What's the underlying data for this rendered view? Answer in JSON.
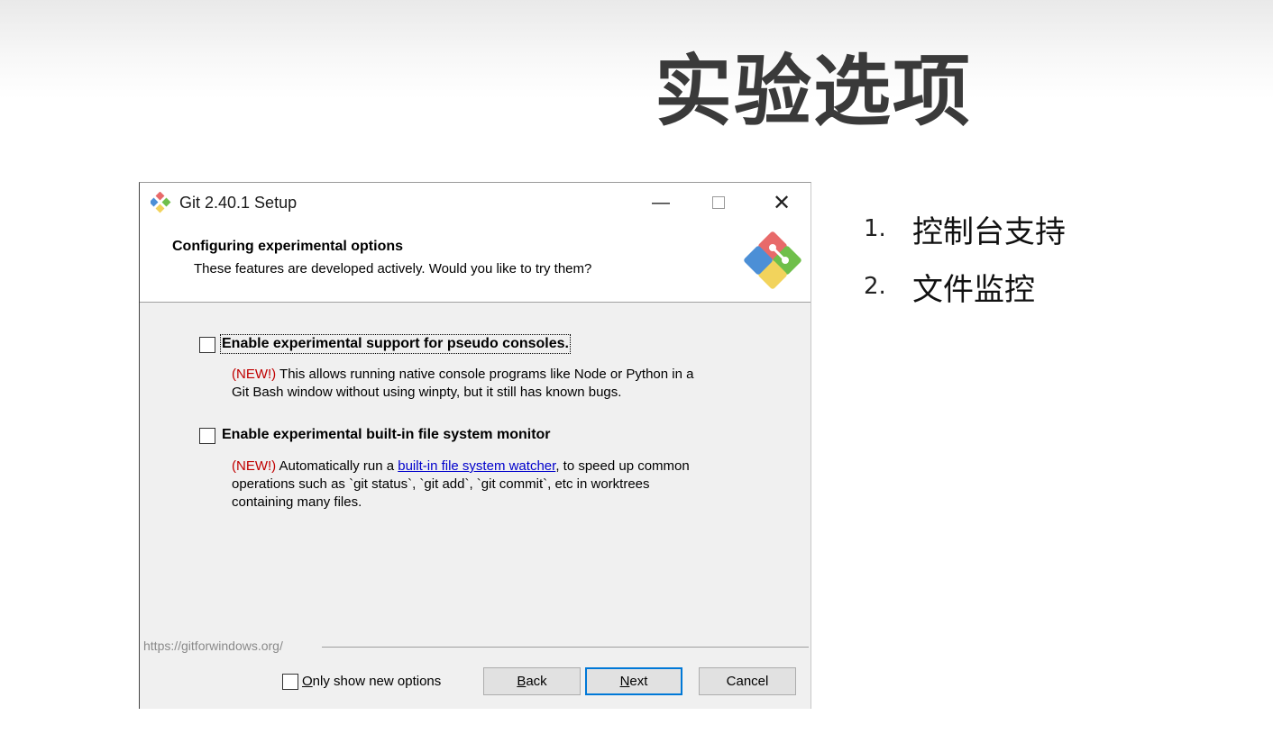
{
  "slide": {
    "title": "实验选项",
    "bullets": [
      {
        "num": "1.",
        "text": "控制台支持"
      },
      {
        "num": "2.",
        "text": "文件监控"
      }
    ]
  },
  "dialog": {
    "title": "Git 2.40.1 Setup",
    "window_controls": {
      "minimize": "—",
      "close": "✕"
    },
    "header_title": "Configuring experimental options",
    "header_subtitle": "These features are developed actively. Would you like to try them?",
    "options": [
      {
        "label": "Enable experimental support for pseudo consoles.",
        "checked": false,
        "new_tag": "(NEW!)",
        "desc_line1": " This allows running native console programs like Node or Python in a",
        "desc_line2": "Git Bash window without using winpty, but it still has known bugs."
      },
      {
        "label": "Enable experimental built-in file system monitor",
        "checked": false,
        "new_tag": "(NEW!)",
        "desc_pre": " Automatically run a ",
        "desc_link": "built-in file system watcher",
        "desc_post": ", to speed up common",
        "desc_line2": "operations such as `git status`, `git add`, `git commit`, etc in worktrees",
        "desc_line3": "containing many files."
      }
    ],
    "footer_url": "https://gitforwindows.org/",
    "only_new": {
      "underline": "O",
      "rest": "nly show new options",
      "checked": false
    },
    "buttons": {
      "back": {
        "u": "B",
        "rest": "ack"
      },
      "next": {
        "u": "N",
        "rest": "ext"
      },
      "cancel": "Cancel"
    }
  },
  "colors": {
    "new_tag": "#c00000",
    "link": "#0000cc",
    "default_button_border": "#0078d7"
  },
  "icons": [
    "git-logo-icon",
    "minimize-icon",
    "maximize-icon",
    "close-icon"
  ]
}
